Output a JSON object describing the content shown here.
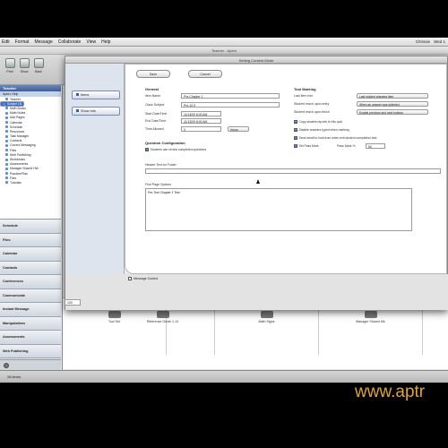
{
  "menubar": {
    "items": [
      "Edit",
      "Format",
      "Message",
      "Collaborate",
      "View",
      "Help"
    ],
    "clock": "Wed 1",
    "user": "Chrissie"
  },
  "window": {
    "title": "Teacher - Aptrio"
  },
  "toolbar": {
    "buttons": [
      "Print",
      "Show",
      "Back"
    ]
  },
  "sidebar": {
    "header": "Teacher",
    "subheader": "Aptrio Help",
    "tree_items": [
      "Teacher",
      "Subject 1B",
      "Studio",
      "Math Books",
      "Math Notes",
      "Add Pages",
      "Calendar",
      "Schedule",
      "Resources",
      "Task Manager",
      "Contacts",
      "Current Messaging",
      "Files",
      "Web Publishing",
      "Workbooks",
      "Assessments",
      "Manager Shared HW",
      "Practice/Plan",
      "Files",
      "Tutorials"
    ],
    "selected_index": 1,
    "sections": [
      "Schedule",
      "Files",
      "Calendar",
      "Contacts",
      "Conferences",
      "Communicate",
      "Instant Message",
      "Manipulatives",
      "Assessments",
      "Web Publishing"
    ]
  },
  "dialog": {
    "title": "Setting Content Mode",
    "left_buttons": [
      "Items",
      "Show Info"
    ],
    "save_label": "Save",
    "cancel_label": "Cancel",
    "general_header": "General",
    "fields": [
      {
        "label": "Item Name",
        "value": "Pre-Chapter 1"
      },
      {
        "label": "Class Subject",
        "value": "Pre-10-9"
      },
      {
        "label": "Start Date/Time",
        "value": "11/13/09 8:00 AM"
      },
      {
        "label": "End Date/Time",
        "value": "11/13/09 8:00 AM"
      },
      {
        "label": "Time Allowed",
        "value": "0",
        "unit": "Hours"
      }
    ],
    "question_header": "Question Configuration",
    "question_check": "Students can review completed questions",
    "intro_label": "Header Text for Folder",
    "first_page_label": "First Page Options",
    "first_page_value": "Pre-Test Chapter 1 Test",
    "tool_header": "Tool Marking",
    "tool_rows": [
      {
        "label": "Last Item Info",
        "value": "Last student answers item"
      },
      {
        "label": "Student reach upon entry",
        "value": "When an answer was selected"
      },
      {
        "label": "Student reach upon finish",
        "value": "Enable previous and next buttons"
      }
    ],
    "tool_checks": [
      "Copy student reports to this quiz",
      "Disable answers typed when marking",
      "Send email to host from when exit student completion test",
      "Set Pass Mark"
    ],
    "pass_mark_label": "Pass Mark %",
    "pass_mark_value": "60",
    "footer_check": "Message Control",
    "zoom_value": "100"
  },
  "content_cards": [
    "Tool Set",
    "Reference Guide 1-13",
    "Math Signs",
    "Manager Shared Mk"
  ],
  "status": {
    "text": "28 items"
  },
  "watermark": "www.aptr",
  "colors": {
    "watermark": "#e2a52f",
    "selection": "#3e6bd1"
  }
}
